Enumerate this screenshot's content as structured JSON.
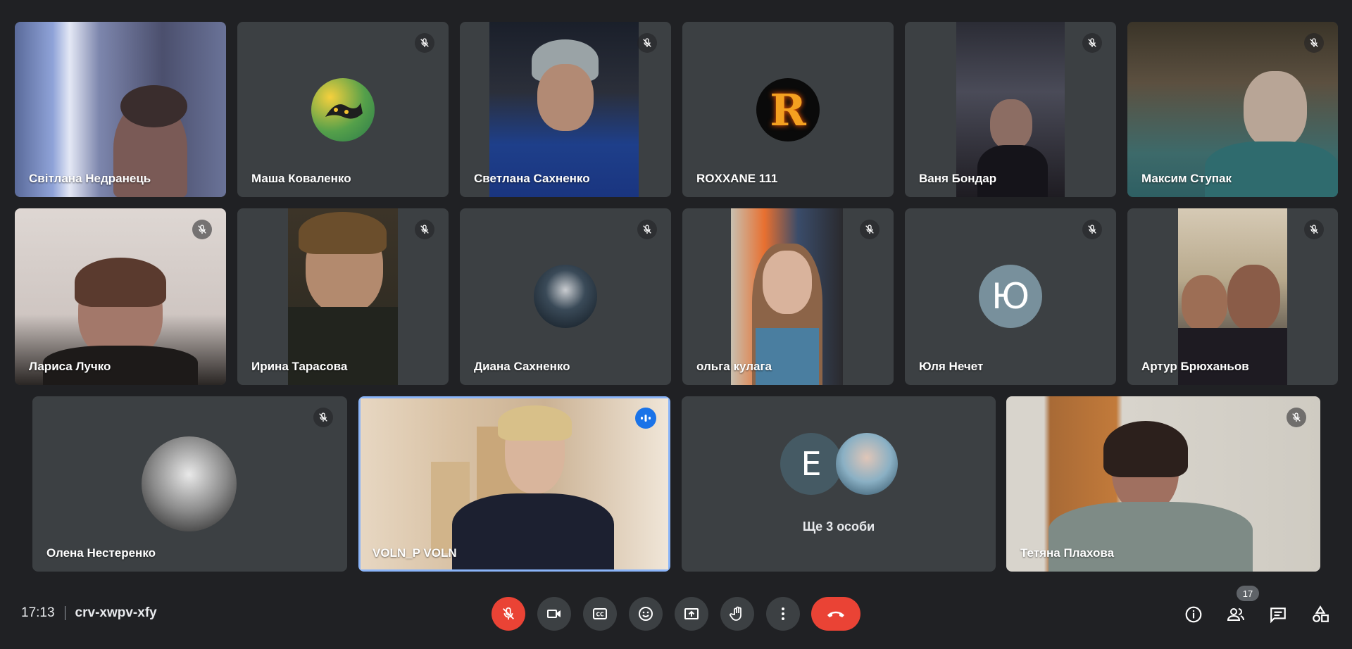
{
  "participants": [
    {
      "name": "Світлана Недранець",
      "muted": false
    },
    {
      "name": "Маша Коваленко",
      "muted": true
    },
    {
      "name": "Светлана Сахненко",
      "muted": true
    },
    {
      "name": "ROXXANE 111",
      "muted": false
    },
    {
      "name": "Ваня Бондар",
      "muted": true
    },
    {
      "name": "Максим Ступак",
      "muted": true
    },
    {
      "name": "Лариса Лучко",
      "muted": true
    },
    {
      "name": "Ирина Тарасова",
      "muted": true
    },
    {
      "name": "Диана Сахненко",
      "muted": true
    },
    {
      "name": "ольга кулага",
      "muted": true
    },
    {
      "name": "Юля Нечет",
      "muted": true,
      "initial": "Ю"
    },
    {
      "name": "Артур Брюханьов",
      "muted": true
    },
    {
      "name": "Олена Нестеренко",
      "muted": true
    },
    {
      "name": "VOLN_P VOLN",
      "speaking": true
    },
    {
      "more_label": "Ще 3 особи",
      "initial": "E"
    },
    {
      "name": "Тетяна Плахова",
      "muted": true
    }
  ],
  "avatars": {
    "roxxane_letter": "R"
  },
  "meeting": {
    "time": "17:13",
    "code": "crv-xwpv-xfy"
  },
  "controls": [
    {
      "icon": "mic-off-icon",
      "label": "Microphone"
    },
    {
      "icon": "camera-icon",
      "label": "Camera"
    },
    {
      "icon": "captions-icon",
      "label": "Captions"
    },
    {
      "icon": "emoji-icon",
      "label": "Reactions"
    },
    {
      "icon": "present-icon",
      "label": "Present"
    },
    {
      "icon": "raise-hand-icon",
      "label": "Raise hand"
    },
    {
      "icon": "more-options-icon",
      "label": "More options"
    },
    {
      "icon": "hangup-icon",
      "label": "Leave call"
    }
  ],
  "right_controls": {
    "people_count": "17"
  },
  "colors": {
    "background": "#202124",
    "tile": "#3c4043",
    "accent": "#8ab4f8",
    "danger": "#ea4335",
    "speaking": "#1a73e8"
  }
}
